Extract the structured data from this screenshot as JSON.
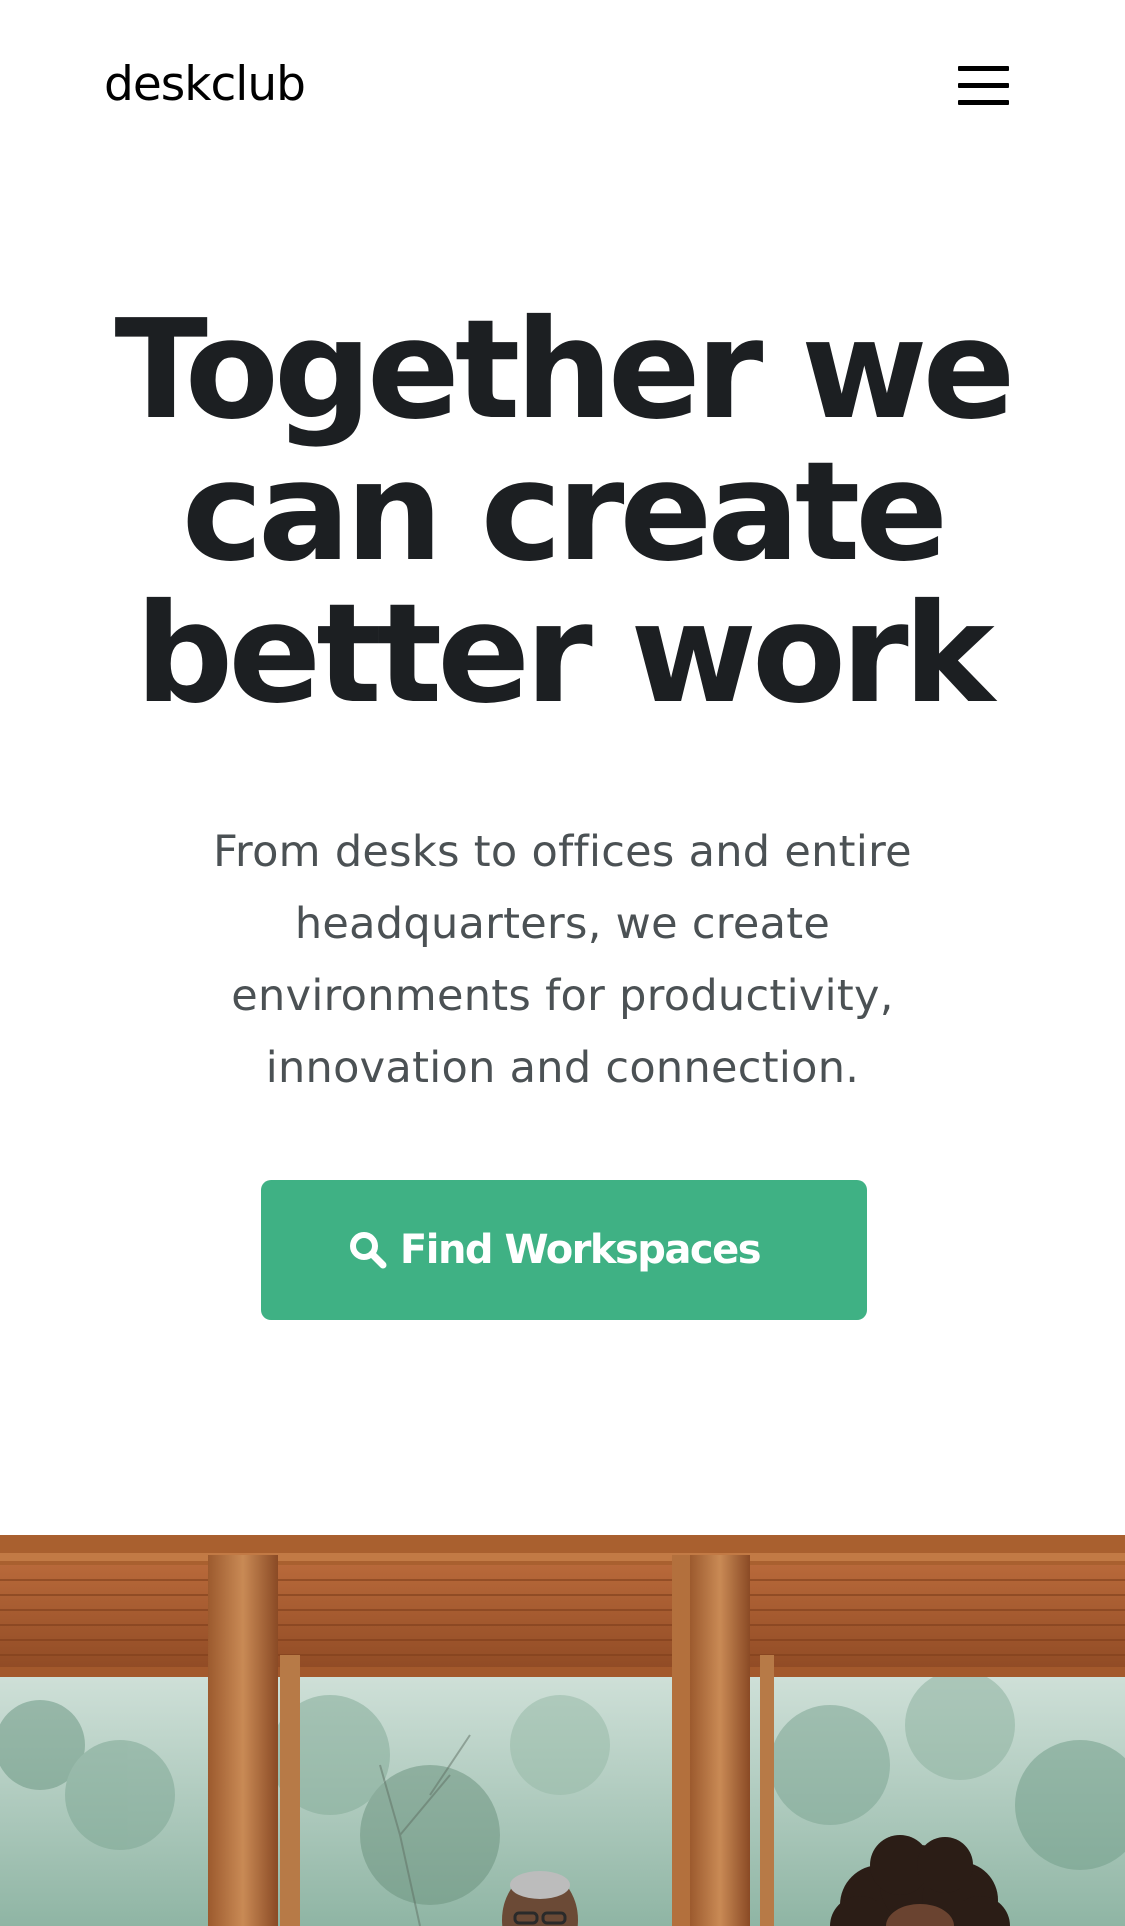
{
  "brand": {
    "logo_text": "deskclub",
    "accent_color": "#3fb184"
  },
  "nav": {
    "menu_icon": "hamburger-menu-icon"
  },
  "hero": {
    "headline": "Together we can create better work",
    "subtext": "From desks to offices and entire headquarters, we create environments for productivity, innovation and connection.",
    "cta_label": "Find Workspaces",
    "cta_icon": "search-icon"
  }
}
